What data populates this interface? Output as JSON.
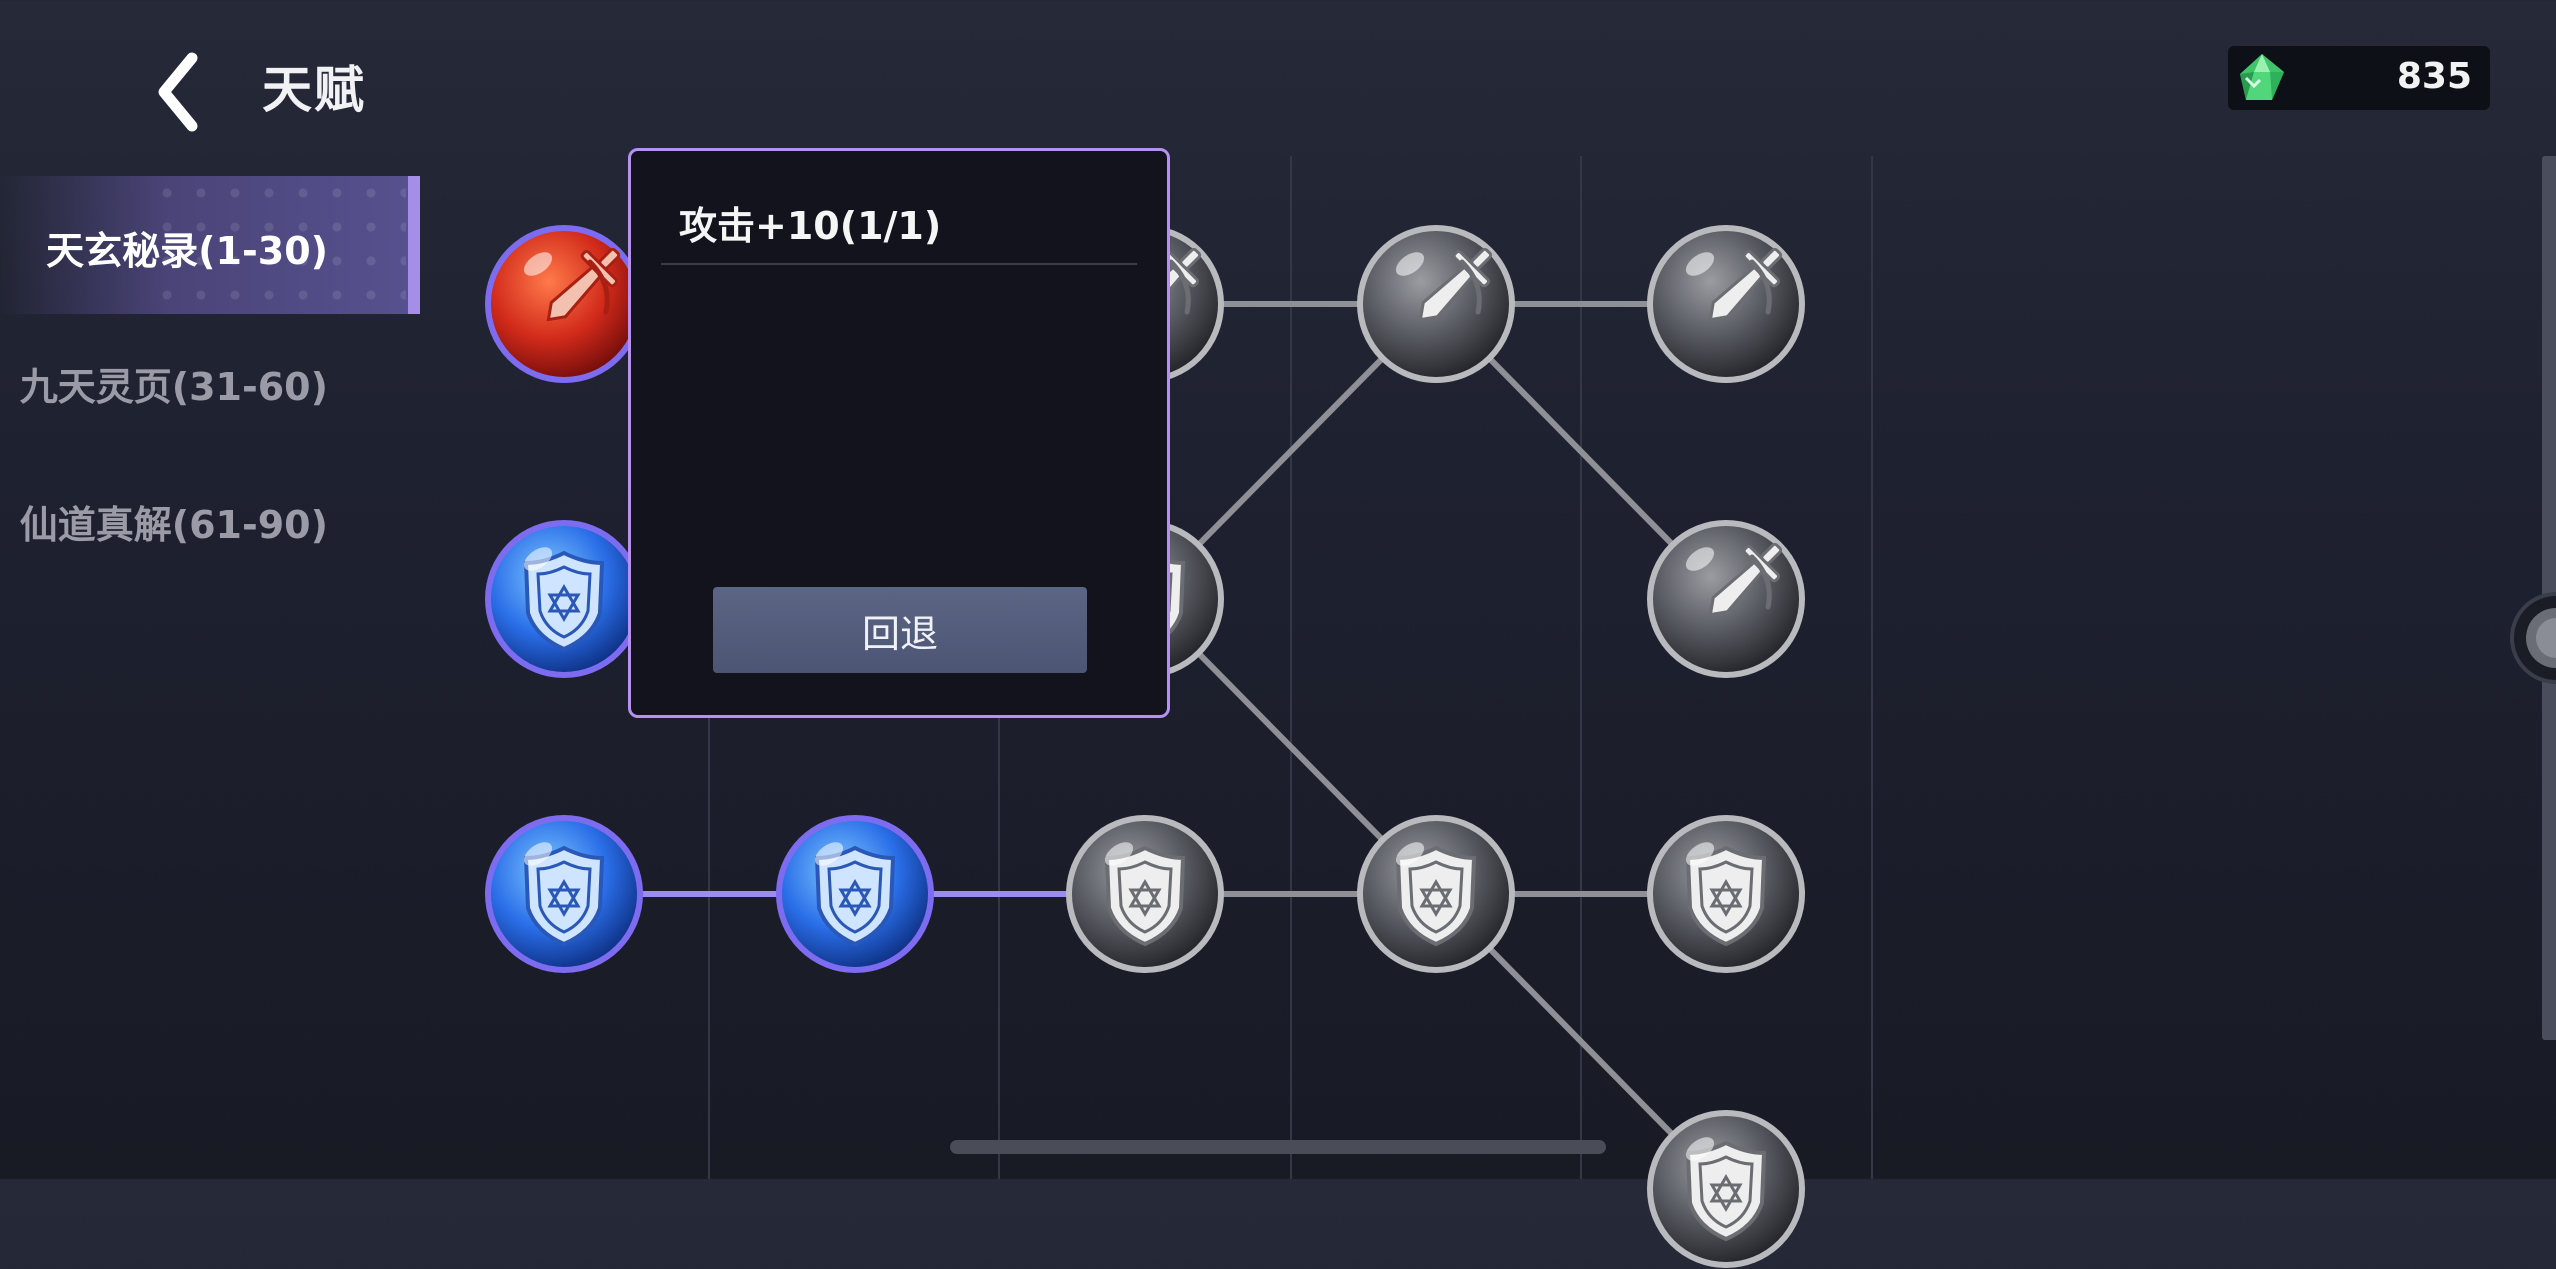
{
  "header": {
    "title": "天赋",
    "back_icon": "chevron-left-icon"
  },
  "currency": {
    "icon": "green-gem-icon",
    "amount": "835",
    "gem_color": "#3fc46a"
  },
  "tabs": [
    {
      "label": "天玄秘录(1-30)",
      "active": true
    },
    {
      "label": "九天灵页(31-60)",
      "active": false
    },
    {
      "label": "仙道真解(61-90)",
      "active": false
    }
  ],
  "talent_tree": {
    "nodes": [
      {
        "id": "n1",
        "row": 0,
        "col": 0,
        "type": "attack",
        "state": "unlocked"
      },
      {
        "id": "n2",
        "row": 0,
        "col": 2,
        "type": "attack",
        "state": "locked"
      },
      {
        "id": "n3",
        "row": 0,
        "col": 3,
        "type": "attack",
        "state": "locked"
      },
      {
        "id": "n4",
        "row": 0,
        "col": 4,
        "type": "attack",
        "state": "locked"
      },
      {
        "id": "n5",
        "row": 1,
        "col": 0,
        "type": "defense",
        "state": "unlocked"
      },
      {
        "id": "n6",
        "row": 1,
        "col": 2,
        "type": "defense",
        "state": "locked"
      },
      {
        "id": "n7",
        "row": 1,
        "col": 4,
        "type": "attack",
        "state": "locked"
      },
      {
        "id": "n8",
        "row": 2,
        "col": 0,
        "type": "defense",
        "state": "unlocked"
      },
      {
        "id": "n9",
        "row": 2,
        "col": 1,
        "type": "defense",
        "state": "unlocked"
      },
      {
        "id": "n10",
        "row": 2,
        "col": 2,
        "type": "defense",
        "state": "locked"
      },
      {
        "id": "n11",
        "row": 2,
        "col": 3,
        "type": "defense",
        "state": "locked"
      },
      {
        "id": "n12",
        "row": 2,
        "col": 4,
        "type": "defense",
        "state": "locked"
      },
      {
        "id": "n13",
        "row": 3,
        "col": 4,
        "type": "defense",
        "state": "locked"
      }
    ],
    "links": [
      {
        "from": "n2",
        "to": "n3",
        "state": "locked"
      },
      {
        "from": "n3",
        "to": "n4",
        "state": "locked"
      },
      {
        "from": "n3",
        "to": "n6",
        "state": "locked"
      },
      {
        "from": "n3",
        "to": "n7",
        "state": "locked"
      },
      {
        "from": "n6",
        "to": "n11",
        "state": "locked"
      },
      {
        "from": "n8",
        "to": "n9",
        "state": "unlocked"
      },
      {
        "from": "n9",
        "to": "n10",
        "state": "unlocked"
      },
      {
        "from": "n10",
        "to": "n11",
        "state": "locked"
      },
      {
        "from": "n11",
        "to": "n12",
        "state": "locked"
      },
      {
        "from": "n11",
        "to": "n13",
        "state": "locked"
      }
    ]
  },
  "popup": {
    "title": "攻击+10(1/1)",
    "rollback_label": "回退"
  }
}
